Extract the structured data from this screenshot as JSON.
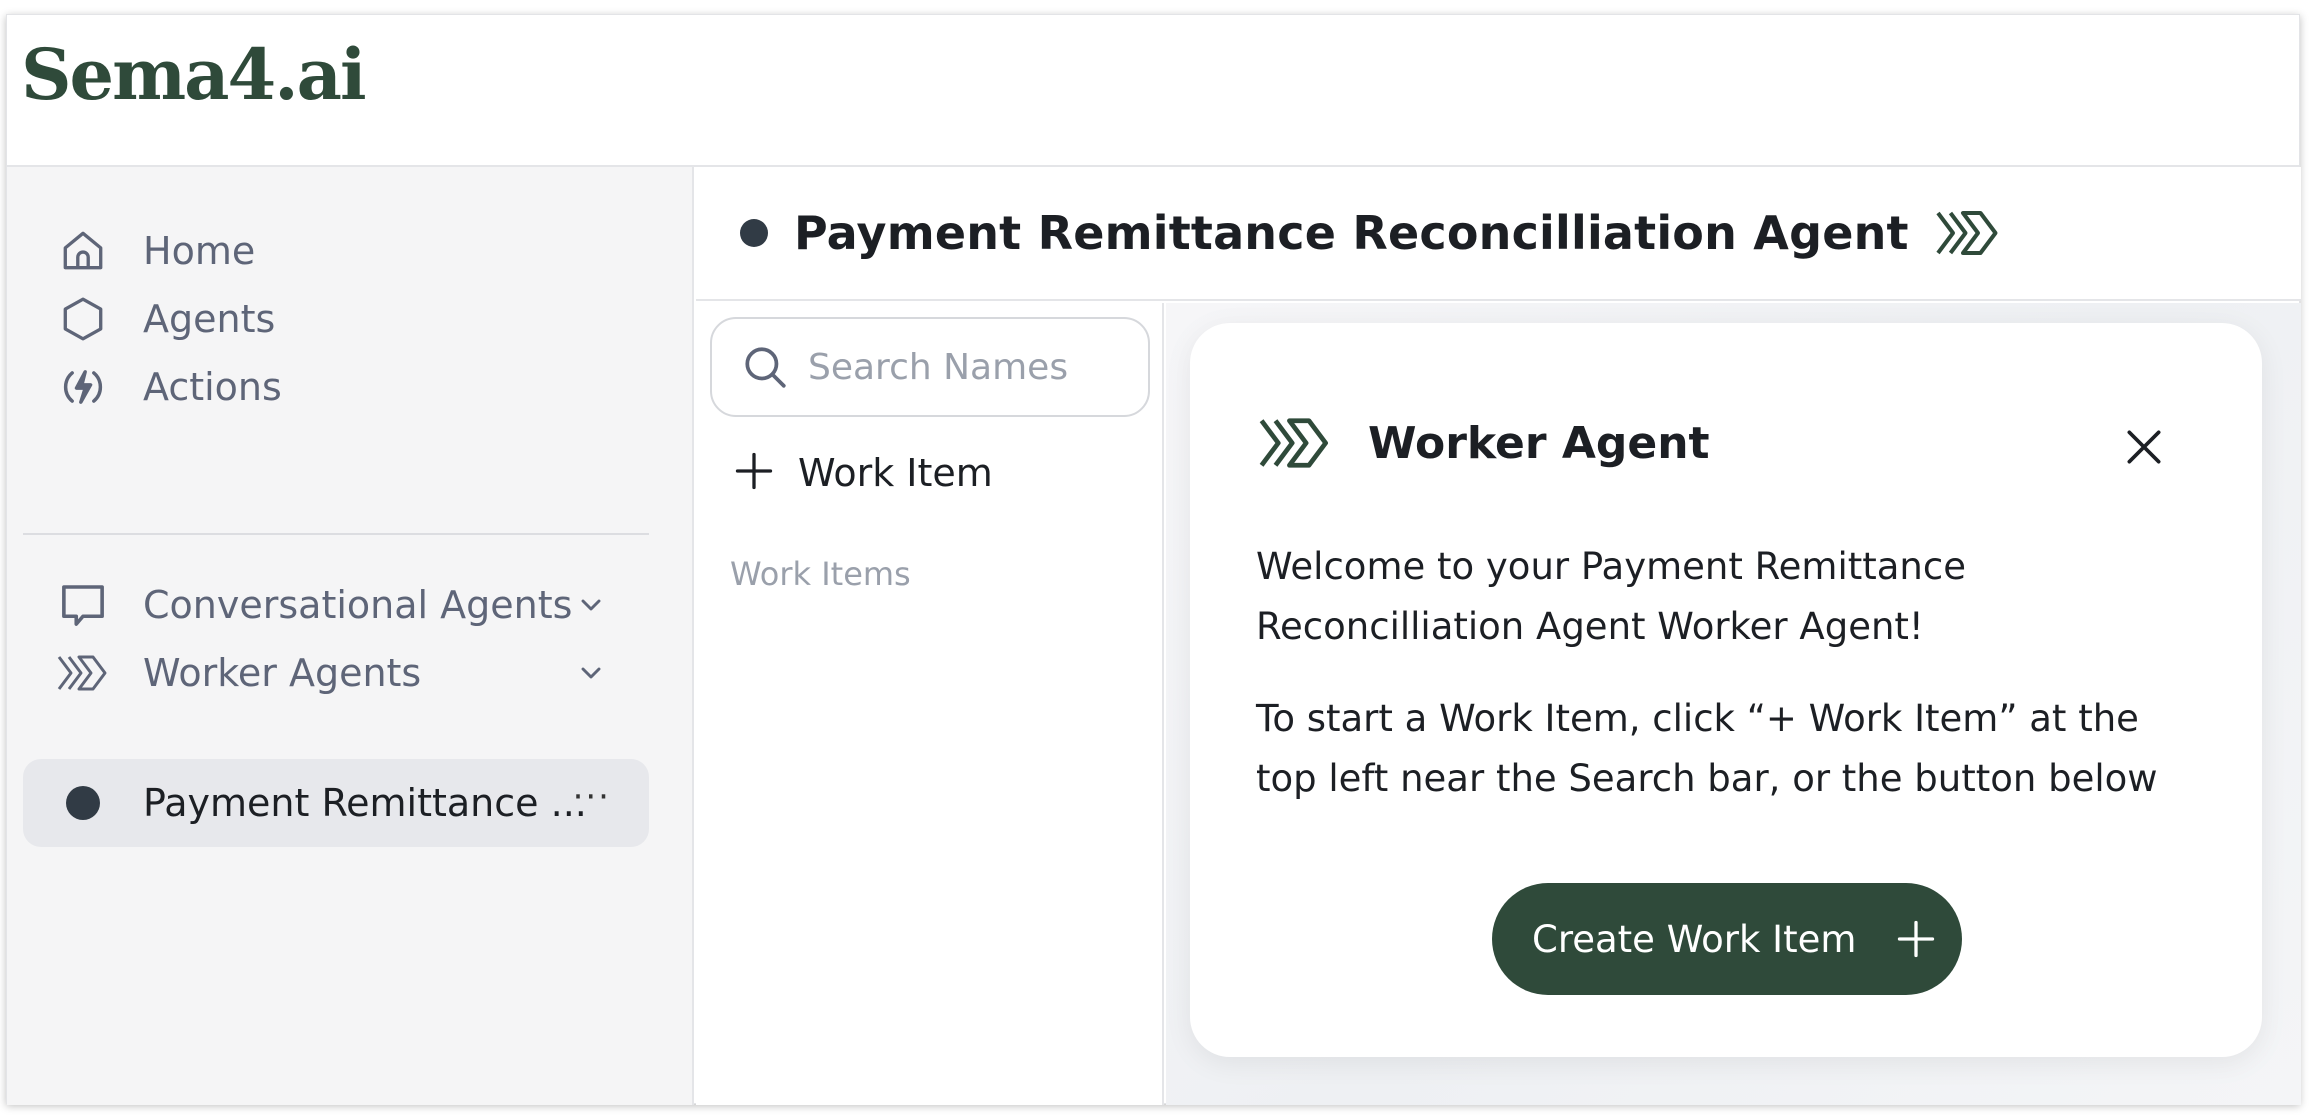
{
  "brand": {
    "logo_text": "Sema4.ai",
    "color": "#2f4a3a"
  },
  "sidebar": {
    "items": [
      {
        "label": "Home",
        "icon": "home-icon"
      },
      {
        "label": "Agents",
        "icon": "hexagon-icon"
      },
      {
        "label": "Actions",
        "icon": "lightning-icon"
      }
    ],
    "groups": [
      {
        "label": "Conversational Agents",
        "icon": "chat-bubble-icon",
        "expand_icon": "chevron-down-icon"
      },
      {
        "label": "Worker Agents",
        "icon": "worker-chevrons-icon",
        "expand_icon": "chevron-down-icon"
      }
    ],
    "active_agent": {
      "label": "Payment Remittance ...",
      "more": "···",
      "status_color": "#313b45"
    }
  },
  "main": {
    "title": "Payment Remittance Reconcilliation Agent",
    "search": {
      "placeholder": "Search Names",
      "value": ""
    },
    "add_work_item_label": "Work Item",
    "work_items_section_label": "Work Items"
  },
  "card": {
    "title": "Worker Agent",
    "welcome_text": "Welcome to your Payment Remittance Reconcilliation Agent Worker Agent!",
    "instructions_text": "To start a Work Item, click “+ Work Item” at the top left near the Search bar, or the button below",
    "cta_label": "Create Work Item"
  }
}
